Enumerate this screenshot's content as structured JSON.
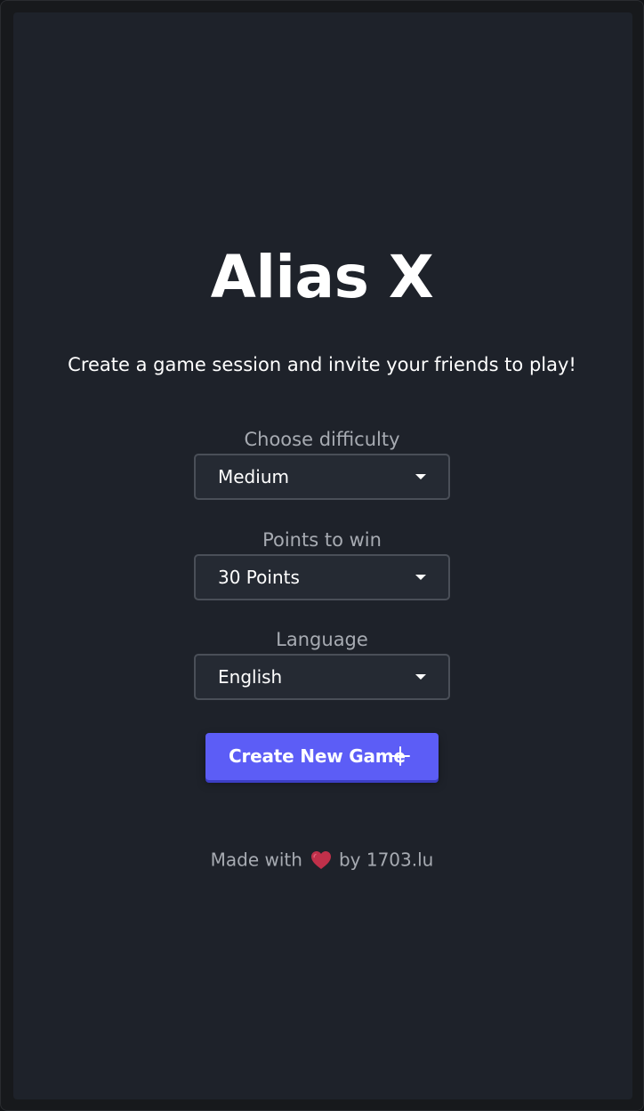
{
  "app": {
    "title": "Alias X",
    "subtitle": "Create a game session and invite your friends to play!"
  },
  "form": {
    "difficulty": {
      "label": "Choose difficulty",
      "value": "Medium"
    },
    "points": {
      "label": "Points to win",
      "value": "30 Points"
    },
    "language": {
      "label": "Language",
      "value": "English"
    },
    "create_button": {
      "label": "Create New Game",
      "icon": "plus-icon"
    }
  },
  "footer": {
    "prefix": "Made with",
    "icon": "heart-icon",
    "suffix": "by 1703.lu"
  },
  "colors": {
    "background": "#1e222a",
    "accent": "#5c5df6",
    "heart": "#c0304a"
  }
}
